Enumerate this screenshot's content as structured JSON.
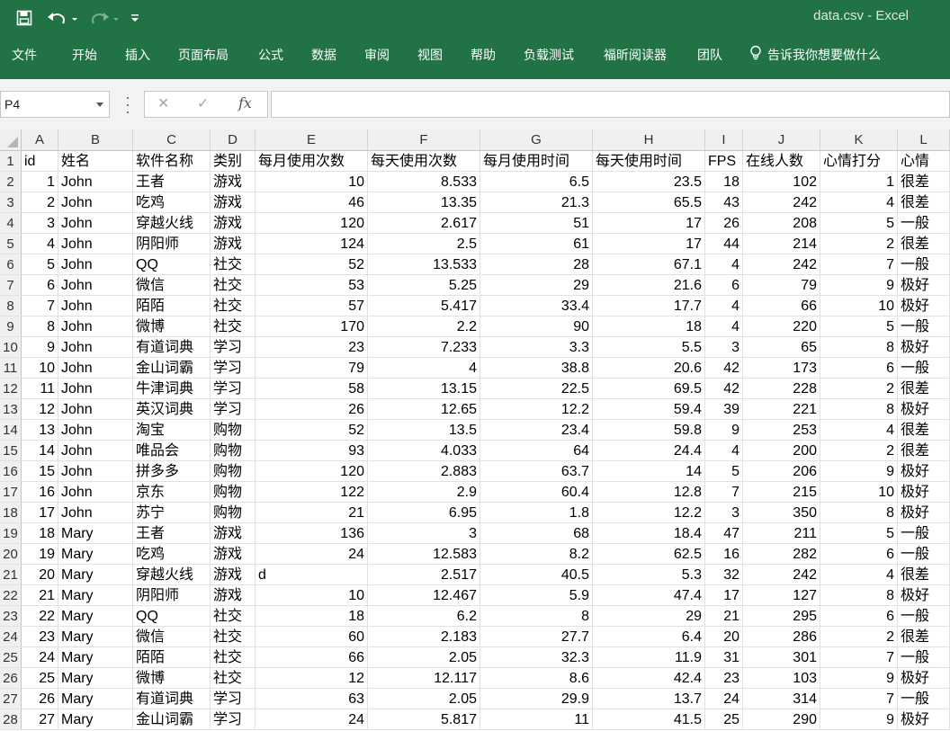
{
  "title_bar": {
    "document_title": "data.csv  -  Excel",
    "icons": [
      "save-icon",
      "undo-icon",
      "redo-icon",
      "customize-qat-icon"
    ]
  },
  "ribbon": {
    "tabs": [
      "文件",
      "开始",
      "插入",
      "页面布局",
      "公式",
      "数据",
      "审阅",
      "视图",
      "帮助",
      "负载测试",
      "福昕阅读器",
      "团队"
    ],
    "tell_me": "告诉我你想要做什么"
  },
  "formula_bar": {
    "name_box": "P4",
    "cancel_symbol": "✕",
    "enter_symbol": "✓",
    "fx_symbol": "fx",
    "formula": ""
  },
  "sheet": {
    "column_letters": [
      "A",
      "B",
      "C",
      "D",
      "E",
      "F",
      "G",
      "H",
      "I",
      "J",
      "K",
      "L"
    ],
    "row_numbers": [
      "1",
      "2",
      "3",
      "4",
      "5",
      "6",
      "7",
      "8",
      "9",
      "10",
      "11",
      "12",
      "13",
      "14",
      "15",
      "16",
      "17",
      "18",
      "19",
      "20",
      "21",
      "22",
      "23",
      "24",
      "25",
      "26",
      "27",
      "28"
    ],
    "rows": [
      [
        "id",
        "姓名",
        "软件名称",
        "类别",
        "每月使用次数",
        "每天使用次数",
        "每月使用时间",
        "每天使用时间",
        "FPS",
        "在线人数",
        "心情打分",
        "心情"
      ],
      [
        "1",
        "John",
        "王者",
        "游戏",
        "10",
        "8.533",
        "6.5",
        "23.5",
        "18",
        "102",
        "1",
        "很差"
      ],
      [
        "2",
        "John",
        "吃鸡",
        "游戏",
        "46",
        "13.35",
        "21.3",
        "65.5",
        "43",
        "242",
        "4",
        "很差"
      ],
      [
        "3",
        "John",
        "穿越火线",
        "游戏",
        "120",
        "2.617",
        "51",
        "17",
        "26",
        "208",
        "5",
        "一般"
      ],
      [
        "4",
        "John",
        "阴阳师",
        "游戏",
        "124",
        "2.5",
        "61",
        "17",
        "44",
        "214",
        "2",
        "很差"
      ],
      [
        "5",
        "John",
        "QQ",
        "社交",
        "52",
        "13.533",
        "28",
        "67.1",
        "4",
        "242",
        "7",
        "一般"
      ],
      [
        "6",
        "John",
        "微信",
        "社交",
        "53",
        "5.25",
        "29",
        "21.6",
        "6",
        "79",
        "9",
        "极好"
      ],
      [
        "7",
        "John",
        "陌陌",
        "社交",
        "57",
        "5.417",
        "33.4",
        "17.7",
        "4",
        "66",
        "10",
        "极好"
      ],
      [
        "8",
        "John",
        "微博",
        "社交",
        "170",
        "2.2",
        "90",
        "18",
        "4",
        "220",
        "5",
        "一般"
      ],
      [
        "9",
        "John",
        "有道词典",
        "学习",
        "23",
        "7.233",
        "3.3",
        "5.5",
        "3",
        "65",
        "8",
        "极好"
      ],
      [
        "10",
        "John",
        "金山词霸",
        "学习",
        "79",
        "4",
        "38.8",
        "20.6",
        "42",
        "173",
        "6",
        "一般"
      ],
      [
        "11",
        "John",
        "牛津词典",
        "学习",
        "58",
        "13.15",
        "22.5",
        "69.5",
        "42",
        "228",
        "2",
        "很差"
      ],
      [
        "12",
        "John",
        "英汉词典",
        "学习",
        "26",
        "12.65",
        "12.2",
        "59.4",
        "39",
        "221",
        "8",
        "极好"
      ],
      [
        "13",
        "John",
        "淘宝",
        "购物",
        "52",
        "13.5",
        "23.4",
        "59.8",
        "9",
        "253",
        "4",
        "很差"
      ],
      [
        "14",
        "John",
        "唯品会",
        "购物",
        "93",
        "4.033",
        "64",
        "24.4",
        "4",
        "200",
        "2",
        "很差"
      ],
      [
        "15",
        "John",
        "拼多多",
        "购物",
        "120",
        "2.883",
        "63.7",
        "14",
        "5",
        "206",
        "9",
        "极好"
      ],
      [
        "16",
        "John",
        "京东",
        "购物",
        "122",
        "2.9",
        "60.4",
        "12.8",
        "7",
        "215",
        "10",
        "极好"
      ],
      [
        "17",
        "John",
        "苏宁",
        "购物",
        "21",
        "6.95",
        "1.8",
        "12.2",
        "3",
        "350",
        "8",
        "极好"
      ],
      [
        "18",
        "Mary",
        "王者",
        "游戏",
        "136",
        "3",
        "68",
        "18.4",
        "47",
        "211",
        "5",
        "一般"
      ],
      [
        "19",
        "Mary",
        "吃鸡",
        "游戏",
        "24",
        "12.583",
        "8.2",
        "62.5",
        "16",
        "282",
        "6",
        "一般"
      ],
      [
        "20",
        "Mary",
        "穿越火线",
        "游戏",
        "d",
        "2.517",
        "40.5",
        "5.3",
        "32",
        "242",
        "4",
        "很差"
      ],
      [
        "21",
        "Mary",
        "阴阳师",
        "游戏",
        "10",
        "12.467",
        "5.9",
        "47.4",
        "17",
        "127",
        "8",
        "极好"
      ],
      [
        "22",
        "Mary",
        "QQ",
        "社交",
        "18",
        "6.2",
        "8",
        "29",
        "21",
        "295",
        "6",
        "一般"
      ],
      [
        "23",
        "Mary",
        "微信",
        "社交",
        "60",
        "2.183",
        "27.7",
        "6.4",
        "20",
        "286",
        "2",
        "很差"
      ],
      [
        "24",
        "Mary",
        "陌陌",
        "社交",
        "66",
        "2.05",
        "32.3",
        "11.9",
        "31",
        "301",
        "7",
        "一般"
      ],
      [
        "25",
        "Mary",
        "微博",
        "社交",
        "12",
        "12.117",
        "8.6",
        "42.4",
        "23",
        "103",
        "9",
        "极好"
      ],
      [
        "26",
        "Mary",
        "有道词典",
        "学习",
        "63",
        "2.05",
        "29.9",
        "13.7",
        "24",
        "314",
        "7",
        "一般"
      ],
      [
        "27",
        "Mary",
        "金山词霸",
        "学习",
        "24",
        "5.817",
        "11",
        "41.5",
        "25",
        "290",
        "9",
        "极好"
      ]
    ]
  },
  "colors": {
    "excel_green": "#217346",
    "header_gray": "#f0f0f0",
    "gridline": "#e1e1e1"
  }
}
